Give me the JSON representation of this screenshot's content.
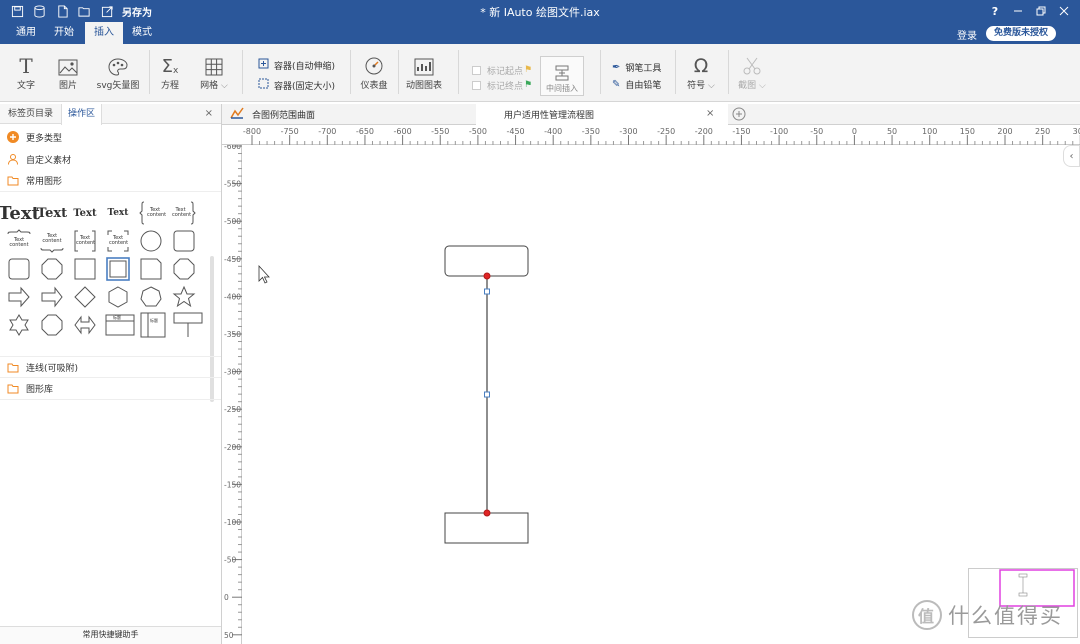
{
  "titlebar": {
    "save_as": "另存为",
    "document_title": "* 新 IAuto 绘图文件.iax",
    "help": "?"
  },
  "menubar": {
    "tabs": [
      {
        "label": "通用"
      },
      {
        "label": "开始"
      },
      {
        "label": "插入",
        "active": true
      },
      {
        "label": "模式"
      }
    ],
    "login": "登录",
    "license": "免费版未授权"
  },
  "ribbon": {
    "text": "文字",
    "image": "图片",
    "svg": "svg矢量图",
    "equation": "方程",
    "grid": "网格",
    "container_auto": "容器(自动伸缩)",
    "container_fixed": "容器(固定大小)",
    "dashboard": "仪表盘",
    "animation": "动图图表",
    "mark_start": "标记起点",
    "mark_end": "标记终点",
    "mid_insert": "中间插入",
    "pen_tool": "钢笔工具",
    "free_pencil": "自由铅笔",
    "symbol": "符号",
    "screenshot": "截图"
  },
  "panel": {
    "tab_bookmarks": "标签页目录",
    "tab_operations": "操作区",
    "close": "×",
    "more_types": "更多类型",
    "custom_material": "自定义素材",
    "common_shapes": "常用图形",
    "connectors": "连线(可吸附)",
    "shape_library": "图形库",
    "footer": "常用快捷键助手",
    "shape_text_sample": "Text",
    "shape_text_content": "Text content",
    "shape_title_sample": "标题"
  },
  "doc_tabs": [
    {
      "label": "合图例范围曲面",
      "active": false
    },
    {
      "label": "用户适用性管理流程图",
      "active": true
    }
  ],
  "rulers": {
    "h_ticks": [
      "-800",
      "-750",
      "-700",
      "-650",
      "-600",
      "-550",
      "-500",
      "-450",
      "-400",
      "-350",
      "-300",
      "-250",
      "-200",
      "-150",
      "-100",
      "-50",
      "0",
      "50",
      "100",
      "150",
      "200",
      "250",
      "300"
    ],
    "v_ticks": [
      "-600",
      "-550",
      "-500",
      "-450",
      "-400",
      "-350",
      "-300",
      "-250",
      "-200",
      "-150",
      "-100",
      "-50",
      "0",
      "50"
    ]
  },
  "watermark": {
    "text": "什么值得买",
    "logo": "值"
  },
  "colors": {
    "brand": "#2b579a",
    "anchor_red": "#e02424",
    "minimap_frame": "#e040e0",
    "midpoint_blue": "#4a7fc1"
  }
}
